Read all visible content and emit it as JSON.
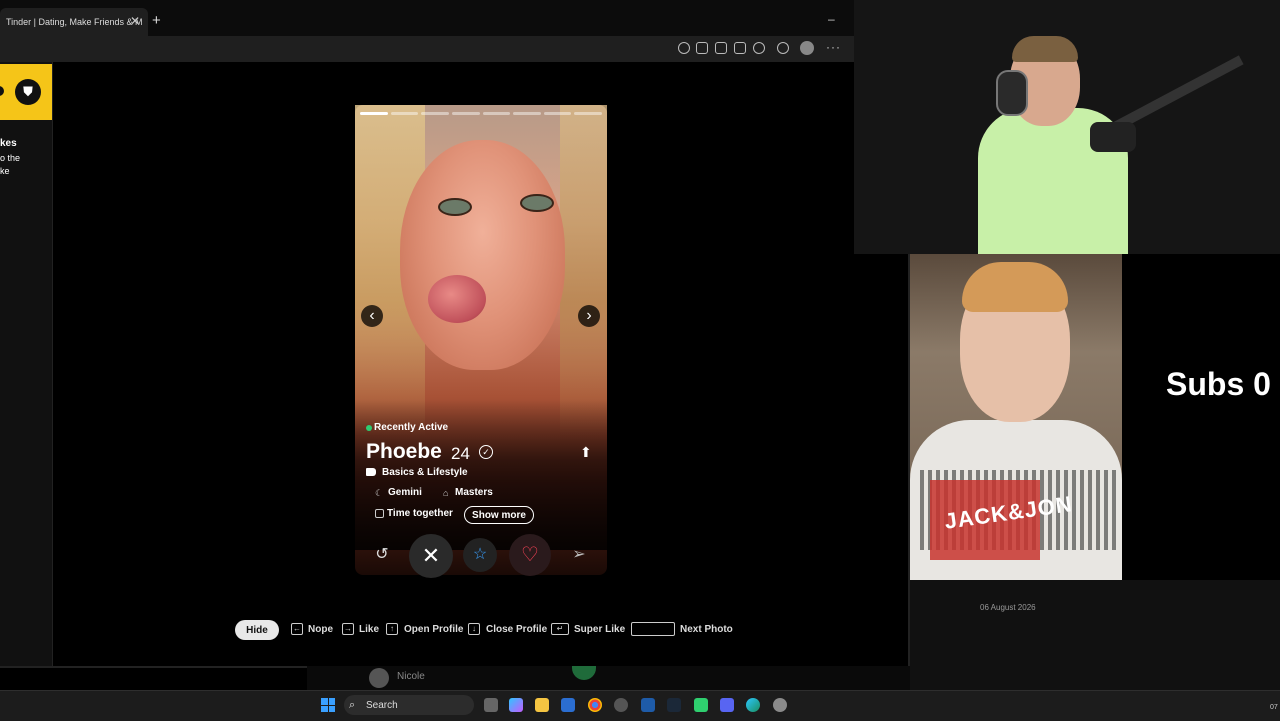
{
  "browser": {
    "tab_title": "Tinder | Dating, Make Friends & M",
    "tab_close": "✕",
    "new_tab": "+",
    "minimize": "–",
    "more": "···"
  },
  "sidebar_promo": {
    "title": "kes",
    "line1": "o the",
    "line2": "ke"
  },
  "profile": {
    "status": "Recently Active",
    "name": "Phoebe",
    "age": "24",
    "tag": "Basics & Lifestyle",
    "zodiac": "Gemini",
    "education": "Masters",
    "looking_for": "Time together",
    "show_more": "Show more",
    "photo_count": 8,
    "current_photo": 1
  },
  "actions": {
    "rewind": "↺",
    "nope": "✕",
    "super_like": "☆",
    "like": "♡",
    "boost": "➢"
  },
  "shortcuts": {
    "hide": "Hide",
    "nope": "Nope",
    "like": "Like",
    "open_profile": "Open Profile",
    "close_profile": "Close Profile",
    "super_like": "Super Like",
    "next_photo": "Next Photo"
  },
  "chat": {
    "name": "Nicole"
  },
  "stream": {
    "subs_text": "Subs 0",
    "date": "06 August 2026",
    "jacket_text": "JACK&JON"
  },
  "taskbar": {
    "search": "Search",
    "clock": "07"
  },
  "colors": {
    "tinder_yellow": "#f5c518",
    "like_red": "#ff4458",
    "super_blue": "#3aa0ff",
    "active_green": "#2ecc71"
  }
}
